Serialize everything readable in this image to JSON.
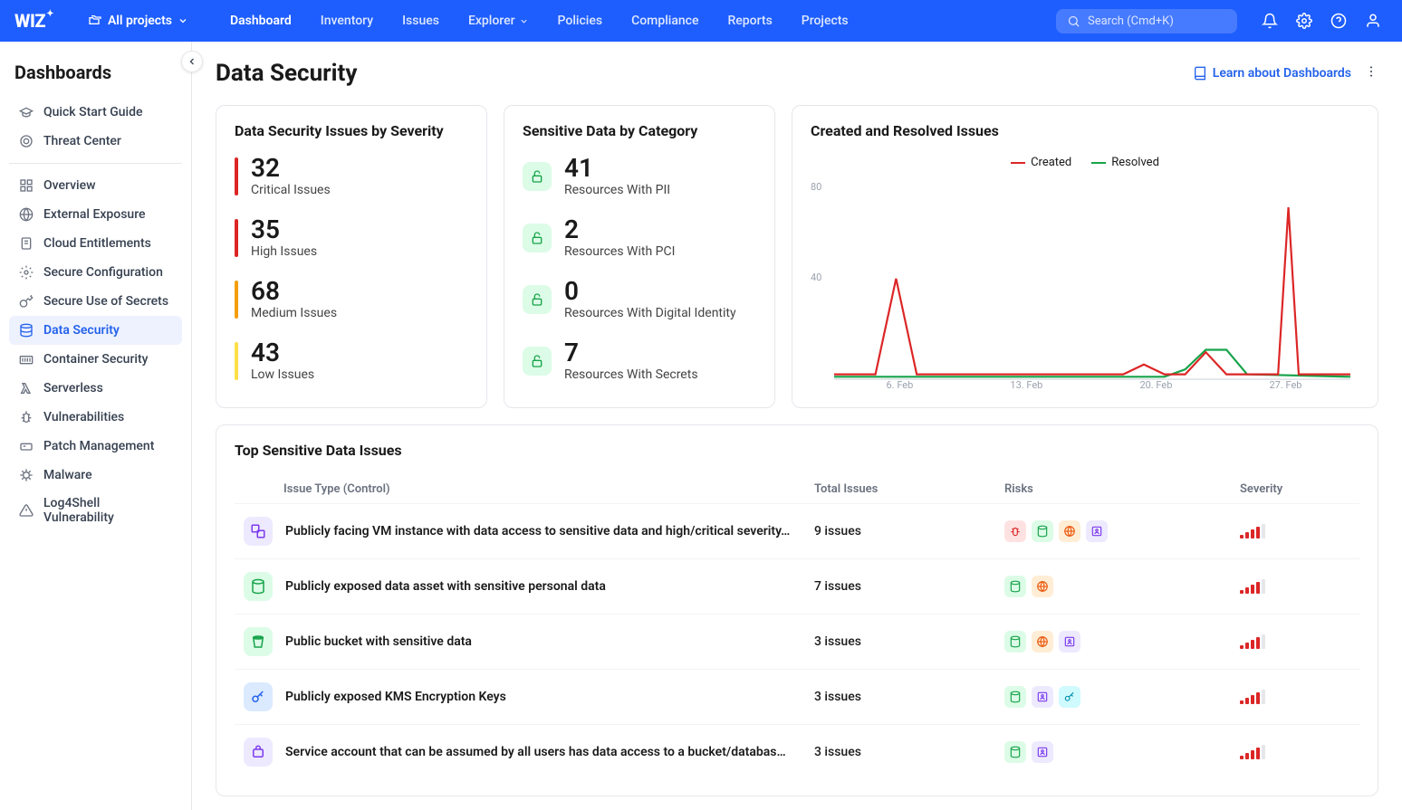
{
  "top": {
    "logo": "WIZ",
    "project_selector": "All projects",
    "nav": [
      "Dashboard",
      "Inventory",
      "Issues",
      "Explorer",
      "Policies",
      "Compliance",
      "Reports",
      "Projects"
    ],
    "active_nav": 0,
    "search_placeholder": "Search (Cmd+K)"
  },
  "sidebar": {
    "title": "Dashboards",
    "groups": [
      {
        "items": [
          {
            "label": "Quick Start Guide",
            "icon": "grad"
          },
          {
            "label": "Threat Center",
            "icon": "target"
          }
        ]
      },
      {
        "items": [
          {
            "label": "Overview",
            "icon": "grid"
          },
          {
            "label": "External Exposure",
            "icon": "globe"
          },
          {
            "label": "Cloud Entitlements",
            "icon": "doc"
          },
          {
            "label": "Secure Configuration",
            "icon": "gear"
          },
          {
            "label": "Secure Use of Secrets",
            "icon": "key"
          },
          {
            "label": "Data Security",
            "icon": "data",
            "active": true
          },
          {
            "label": "Container Security",
            "icon": "container"
          },
          {
            "label": "Serverless",
            "icon": "lambda"
          },
          {
            "label": "Vulnerabilities",
            "icon": "bug"
          },
          {
            "label": "Patch Management",
            "icon": "patch"
          },
          {
            "label": "Malware",
            "icon": "malware"
          },
          {
            "label": "Log4Shell Vulnerability",
            "icon": "alert"
          }
        ]
      }
    ]
  },
  "page": {
    "title": "Data Security",
    "learn_link": "Learn about Dashboards"
  },
  "severity_card": {
    "title": "Data Security Issues by Severity",
    "items": [
      {
        "count": 32,
        "label": "Critical Issues",
        "color": "#dc2626"
      },
      {
        "count": 35,
        "label": "High Issues",
        "color": "#dc2626"
      },
      {
        "count": 68,
        "label": "Medium Issues",
        "color": "#f59e0b"
      },
      {
        "count": 43,
        "label": "Low Issues",
        "color": "#fde047"
      }
    ]
  },
  "category_card": {
    "title": "Sensitive Data by Category",
    "items": [
      {
        "count": 41,
        "label": "Resources With PII"
      },
      {
        "count": 2,
        "label": "Resources With PCI"
      },
      {
        "count": 0,
        "label": "Resources With Digital Identity"
      },
      {
        "count": 7,
        "label": "Resources With Secrets"
      }
    ]
  },
  "chart_card": {
    "title": "Created and Resolved Issues",
    "legend": [
      {
        "name": "Created",
        "color": "#dc2626"
      },
      {
        "name": "Resolved",
        "color": "#16a34a"
      }
    ],
    "y_ticks": [
      "80",
      "40"
    ],
    "x_ticks": [
      "6. Feb",
      "13. Feb",
      "20. Feb",
      "27. Feb"
    ]
  },
  "chart_data": {
    "type": "line",
    "title": "Created and Resolved Issues",
    "xlabel": "",
    "ylabel": "",
    "ylim": [
      0,
      80
    ],
    "categories": [
      "6. Feb",
      "13. Feb",
      "20. Feb",
      "27. Feb"
    ],
    "series": [
      {
        "name": "Created",
        "color": "#dc2626",
        "values": [
          {
            "x": 0,
            "y": 2
          },
          {
            "x": 2,
            "y": 2
          },
          {
            "x": 3,
            "y": 41
          },
          {
            "x": 4,
            "y": 2
          },
          {
            "x": 6,
            "y": 2
          },
          {
            "x": 14,
            "y": 2
          },
          {
            "x": 15,
            "y": 6
          },
          {
            "x": 16,
            "y": 2
          },
          {
            "x": 17,
            "y": 2
          },
          {
            "x": 18,
            "y": 11
          },
          {
            "x": 19,
            "y": 2
          },
          {
            "x": 20,
            "y": 2
          },
          {
            "x": 21.5,
            "y": 2
          },
          {
            "x": 22,
            "y": 70
          },
          {
            "x": 22.5,
            "y": 2
          },
          {
            "x": 24,
            "y": 2
          },
          {
            "x": 25,
            "y": 2
          }
        ]
      },
      {
        "name": "Resolved",
        "color": "#16a34a",
        "values": [
          {
            "x": 0,
            "y": 1
          },
          {
            "x": 14,
            "y": 1
          },
          {
            "x": 16,
            "y": 1
          },
          {
            "x": 17,
            "y": 4
          },
          {
            "x": 18,
            "y": 12
          },
          {
            "x": 19,
            "y": 12
          },
          {
            "x": 20,
            "y": 2
          },
          {
            "x": 25,
            "y": 1
          }
        ]
      }
    ]
  },
  "issues_table": {
    "title": "Top Sensitive Data Issues",
    "columns": [
      "Issue Type (Control)",
      "Total Issues",
      "Risks",
      "Severity"
    ],
    "rows": [
      {
        "icon": "vm",
        "icon_bg": "#ede9fe",
        "icon_color": "#7c3aed",
        "type": "Publicly facing VM instance with data access to sensitive data and high/critical severity…",
        "total": "9 issues",
        "risks": [
          "bug",
          "data",
          "globe",
          "id"
        ],
        "severity": 4
      },
      {
        "icon": "data",
        "icon_bg": "#dcfce7",
        "icon_color": "#16a34a",
        "type": "Publicly exposed data asset with sensitive personal data",
        "total": "7 issues",
        "risks": [
          "data",
          "globe"
        ],
        "severity": 4
      },
      {
        "icon": "bucket",
        "icon_bg": "#dcfce7",
        "icon_color": "#16a34a",
        "type": "Public bucket with sensitive data",
        "total": "3 issues",
        "risks": [
          "data",
          "globe",
          "id"
        ],
        "severity": 4
      },
      {
        "icon": "kms",
        "icon_bg": "#dbeafe",
        "icon_color": "#2563eb",
        "type": "Publicly exposed KMS Encryption Keys",
        "total": "3 issues",
        "risks": [
          "data",
          "id",
          "kms"
        ],
        "severity": 4
      },
      {
        "icon": "svc",
        "icon_bg": "#ede9fe",
        "icon_color": "#7c3aed",
        "type": "Service account that can be assumed by all users has data access to a bucket/database…",
        "total": "3 issues",
        "risks": [
          "data",
          "id"
        ],
        "severity": 4
      }
    ]
  },
  "colors": {
    "risk_bug": "#fee2e2",
    "risk_data": "#dcfce7",
    "risk_globe": "#ffedd5",
    "risk_id": "#ede9fe",
    "risk_kms": "#cffafe"
  }
}
